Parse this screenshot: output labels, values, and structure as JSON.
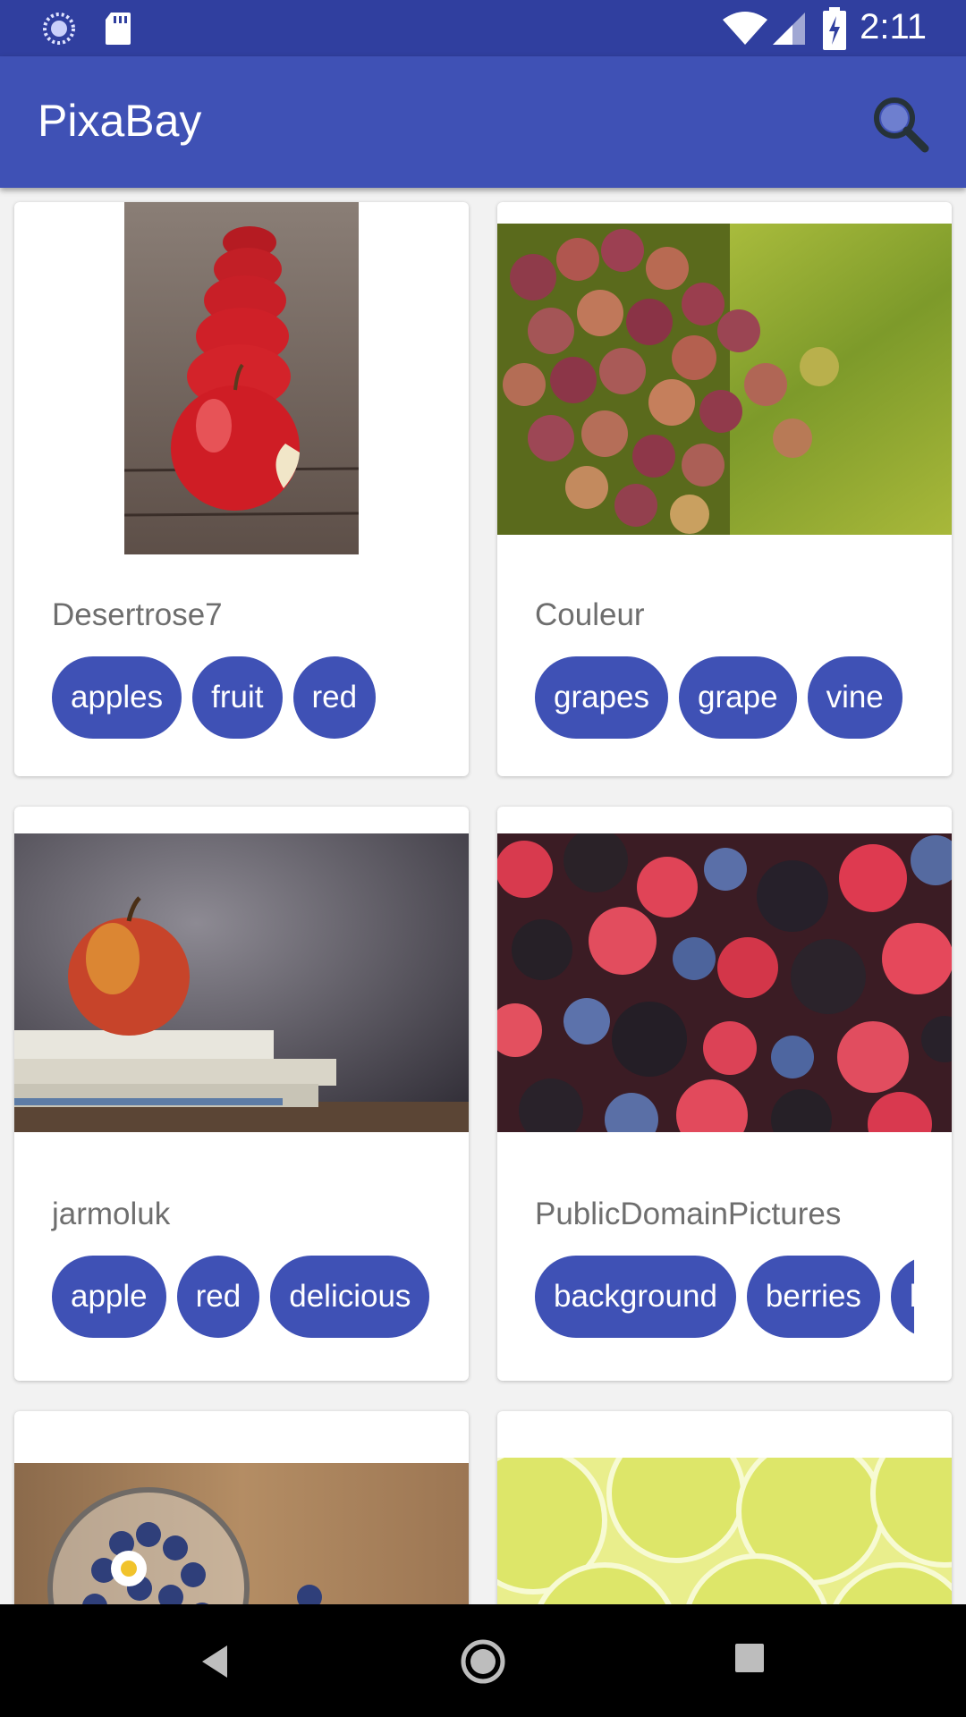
{
  "status_bar": {
    "time": "2:11",
    "icons": [
      "sync-icon",
      "sd-card-icon",
      "wifi-icon",
      "signal-icon",
      "battery-charging-icon"
    ]
  },
  "app_bar": {
    "title": "PixaBay",
    "search_icon": "search-icon"
  },
  "cards": [
    {
      "user": "Desertrose7",
      "image": "red apples in a row, front apple bitten",
      "tags": [
        "apples",
        "fruit",
        "red"
      ]
    },
    {
      "user": "Couleur",
      "image": "red grape bunch with green leaves",
      "tags": [
        "grapes",
        "grape",
        "vine"
      ]
    },
    {
      "user": "jarmoluk",
      "image": "red apple on stack of books",
      "tags": [
        "apple",
        "red",
        "delicious"
      ]
    },
    {
      "user": "PublicDomainPictures",
      "image": "mixed berries: raspberries, blackberries, blueberries",
      "tags": [
        "background",
        "berries",
        "blackberries"
      ]
    },
    {
      "user": "",
      "image": "blueberries in glass bowl with daisy",
      "tags": []
    },
    {
      "user": "",
      "image": "lime slices",
      "tags": []
    }
  ],
  "nav_bar": {
    "icons": [
      "back-icon",
      "home-icon",
      "recents-icon"
    ]
  },
  "colors": {
    "status_bar": "#303f9f",
    "app_bar": "#3f51b5",
    "tag_chip": "#3f51b5",
    "background": "#f2f2f2"
  }
}
